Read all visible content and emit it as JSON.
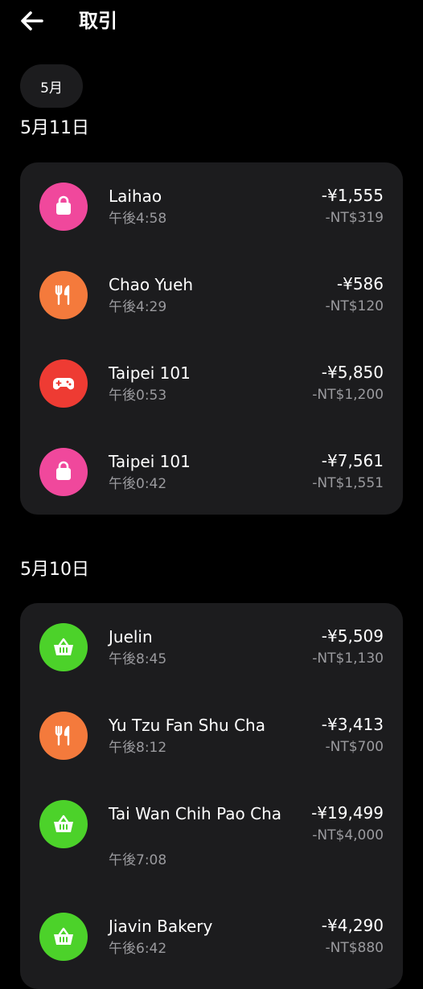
{
  "header": {
    "title": "取引",
    "back_icon": "arrow-left-icon"
  },
  "month_filter": {
    "label": "5月"
  },
  "groups": [
    {
      "date": "5月11日",
      "transactions": [
        {
          "merchant": "Laihao",
          "time": "午後4:58",
          "amount": "-¥1,555",
          "amount_local": "-NT$319",
          "icon": "shopping-bag-icon",
          "color": "#f0489c"
        },
        {
          "merchant": "Chao Yueh",
          "time": "午後4:29",
          "amount": "-¥586",
          "amount_local": "-NT$120",
          "icon": "fork-knife-icon",
          "color": "#f47a3c"
        },
        {
          "merchant": "Taipei 101",
          "time": "午後0:53",
          "amount": "-¥5,850",
          "amount_local": "-NT$1,200",
          "icon": "gamepad-icon",
          "color": "#ee3b33"
        },
        {
          "merchant": "Taipei 101",
          "time": "午後0:42",
          "amount": "-¥7,561",
          "amount_local": "-NT$1,551",
          "icon": "shopping-bag-icon",
          "color": "#f0489c"
        }
      ]
    },
    {
      "date": "5月10日",
      "transactions": [
        {
          "merchant": "Juelin",
          "time": "午後8:45",
          "amount": "-¥5,509",
          "amount_local": "-NT$1,130",
          "icon": "basket-icon",
          "color": "#4cd22a"
        },
        {
          "merchant": "Yu Tzu Fan Shu Cha",
          "time": "午後8:12",
          "amount": "-¥3,413",
          "amount_local": "-NT$700",
          "icon": "fork-knife-icon",
          "color": "#f47a3c"
        },
        {
          "merchant": "Tai Wan Chih Pao Cha",
          "time": "午後7:08",
          "amount": "-¥19,499",
          "amount_local": "-NT$4,000",
          "icon": "basket-icon",
          "color": "#4cd22a"
        },
        {
          "merchant": "Jiavin Bakery",
          "time": "午後6:42",
          "amount": "-¥4,290",
          "amount_local": "-NT$880",
          "icon": "basket-icon",
          "color": "#4cd22a"
        }
      ]
    }
  ]
}
